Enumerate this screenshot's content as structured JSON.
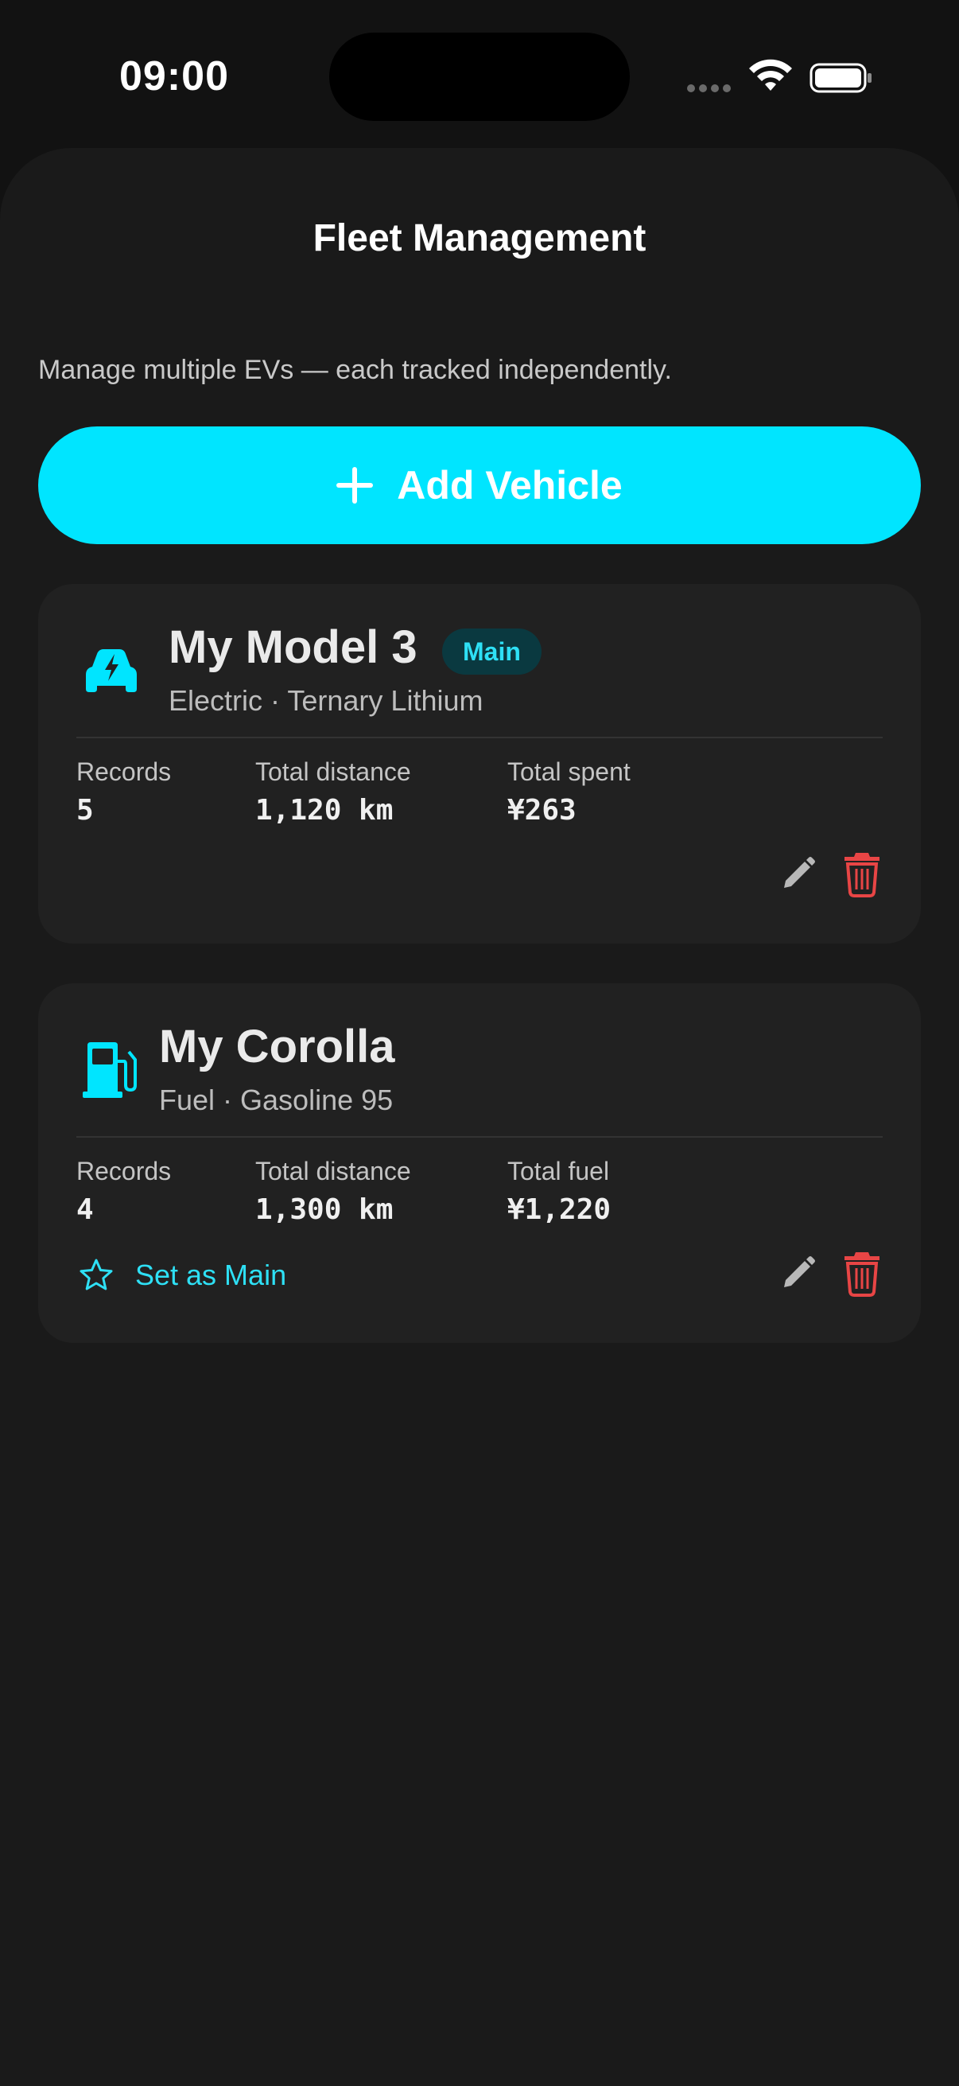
{
  "status_bar": {
    "time": "09:00"
  },
  "header": {
    "title": "Fleet Management"
  },
  "subtitle": "Manage multiple EVs — each tracked independently.",
  "add_button": {
    "label": "Add Vehicle"
  },
  "colors": {
    "accent": "#00e5ff",
    "danger": "#e84545",
    "background": "#121212",
    "card": "#212121"
  },
  "vehicles": [
    {
      "name": "My Model 3",
      "badge": "Main",
      "type": "Electric",
      "detail": "Ternary Lithium",
      "icon": "ev-car-icon",
      "stats": [
        {
          "label": "Records",
          "value": "5"
        },
        {
          "label": "Total distance",
          "value": "1,120 km"
        },
        {
          "label": "Total spent",
          "value": "¥263"
        }
      ]
    },
    {
      "name": "My Corolla",
      "type": "Fuel",
      "detail": "Gasoline 95",
      "icon": "fuel-pump-icon",
      "set_main_label": "Set as Main",
      "stats": [
        {
          "label": "Records",
          "value": "4"
        },
        {
          "label": "Total distance",
          "value": "1,300 km"
        },
        {
          "label": "Total fuel",
          "value": "¥1,220"
        }
      ]
    }
  ]
}
